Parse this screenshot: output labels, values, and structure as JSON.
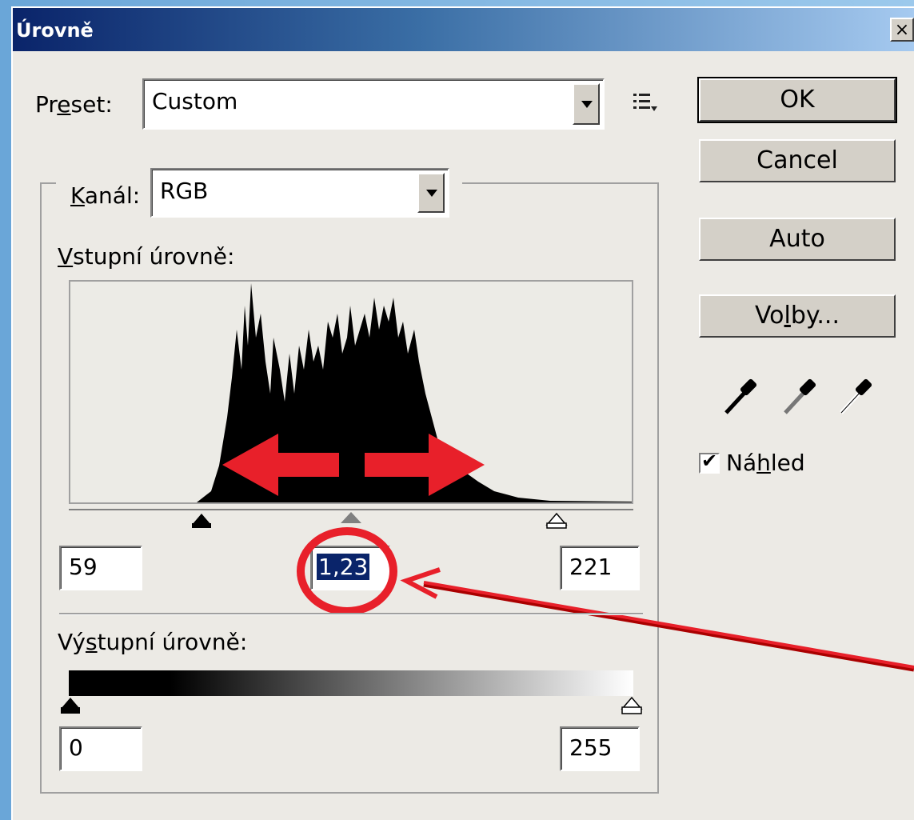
{
  "window": {
    "title": "Úrovně",
    "close_symbol": "×"
  },
  "preset": {
    "label_pre": "Pr",
    "label_u": "e",
    "label_post": "set:",
    "value": "Custom"
  },
  "channel": {
    "label_u": "K",
    "label_post": "aná",
    "label_end": "l:",
    "value": "RGB"
  },
  "input_levels": {
    "label_u": "V",
    "label_post": "stupní úrovně:",
    "black": "59",
    "gamma": "1,23",
    "white": "221"
  },
  "output_levels": {
    "label_pre": "Vý",
    "label_u": "s",
    "label_post": "tupní úrovně:",
    "black": "0",
    "white": "255"
  },
  "buttons": {
    "ok": "OK",
    "cancel": "Cancel",
    "auto": "Auto",
    "options_pre": "Vo",
    "options_u": "l",
    "options_post": "by..."
  },
  "preview": {
    "label_pre": "Ná",
    "label_u": "h",
    "label_post": "led",
    "checked": true
  },
  "colors": {
    "annotation": "#e8202a",
    "selection": "#0a246a"
  }
}
